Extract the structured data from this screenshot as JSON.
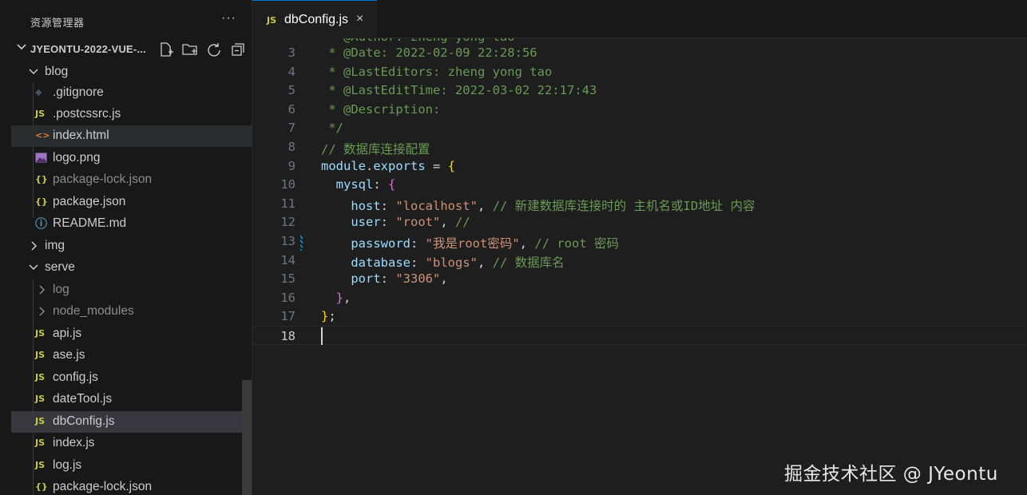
{
  "explorer": {
    "title": "资源管理器",
    "more": "···",
    "project_name": "JYEONTU-2022-VUE-...",
    "items": [
      {
        "label": "blog",
        "kind": "folder-open"
      },
      {
        "label": ".gitignore",
        "kind": "git"
      },
      {
        "label": ".postcssrc.js",
        "kind": "js"
      },
      {
        "label": "index.html",
        "kind": "html"
      },
      {
        "label": "logo.png",
        "kind": "image"
      },
      {
        "label": "package-lock.json",
        "kind": "json"
      },
      {
        "label": "package.json",
        "kind": "json"
      },
      {
        "label": "README.md",
        "kind": "info"
      },
      {
        "label": "img",
        "kind": "folder-closed"
      },
      {
        "label": "serve",
        "kind": "folder-open"
      },
      {
        "label": "log",
        "kind": "folder-closed"
      },
      {
        "label": "node_modules",
        "kind": "folder-closed"
      },
      {
        "label": "api.js",
        "kind": "js"
      },
      {
        "label": "ase.js",
        "kind": "js"
      },
      {
        "label": "config.js",
        "kind": "js"
      },
      {
        "label": "dateTool.js",
        "kind": "js"
      },
      {
        "label": "dbConfig.js",
        "kind": "js"
      },
      {
        "label": "index.js",
        "kind": "js"
      },
      {
        "label": "log.js",
        "kind": "js"
      },
      {
        "label": "package-lock.json",
        "kind": "json"
      }
    ]
  },
  "icons": {
    "js": "JS",
    "json": "{}",
    "html": "<>",
    "info": "ⓘ",
    "git": "◆"
  },
  "tab": {
    "badge": "JS",
    "label": "dbConfig.js",
    "close": "×"
  },
  "editor": {
    "line_numbers": [
      "3",
      "4",
      "5",
      "6",
      "7",
      "8",
      "9",
      "10",
      "11",
      "12",
      "13",
      "14",
      "15",
      "16",
      "17",
      "18"
    ],
    "lines": [
      " * @Date: 2022-02-09 22:28:56",
      " * @LastEditors: zheng yong tao",
      " * @LastEditTime: 2022-03-02 22:17:43",
      " * @Description:",
      " */",
      "// 数据库连接配置",
      "module.exports = {",
      "  mysql: {",
      "    host: \"localhost\", // 新建数据库连接时的 主机名或ID地址 内容",
      "    user: \"root\", //",
      "    password: \"我是root密码\", // root 密码",
      "    database: \"blogs\", // 数据库名",
      "    port: \"3306\",",
      "  },",
      "};",
      ""
    ]
  },
  "watermark": "掘金技术社区 @ JYeontu"
}
